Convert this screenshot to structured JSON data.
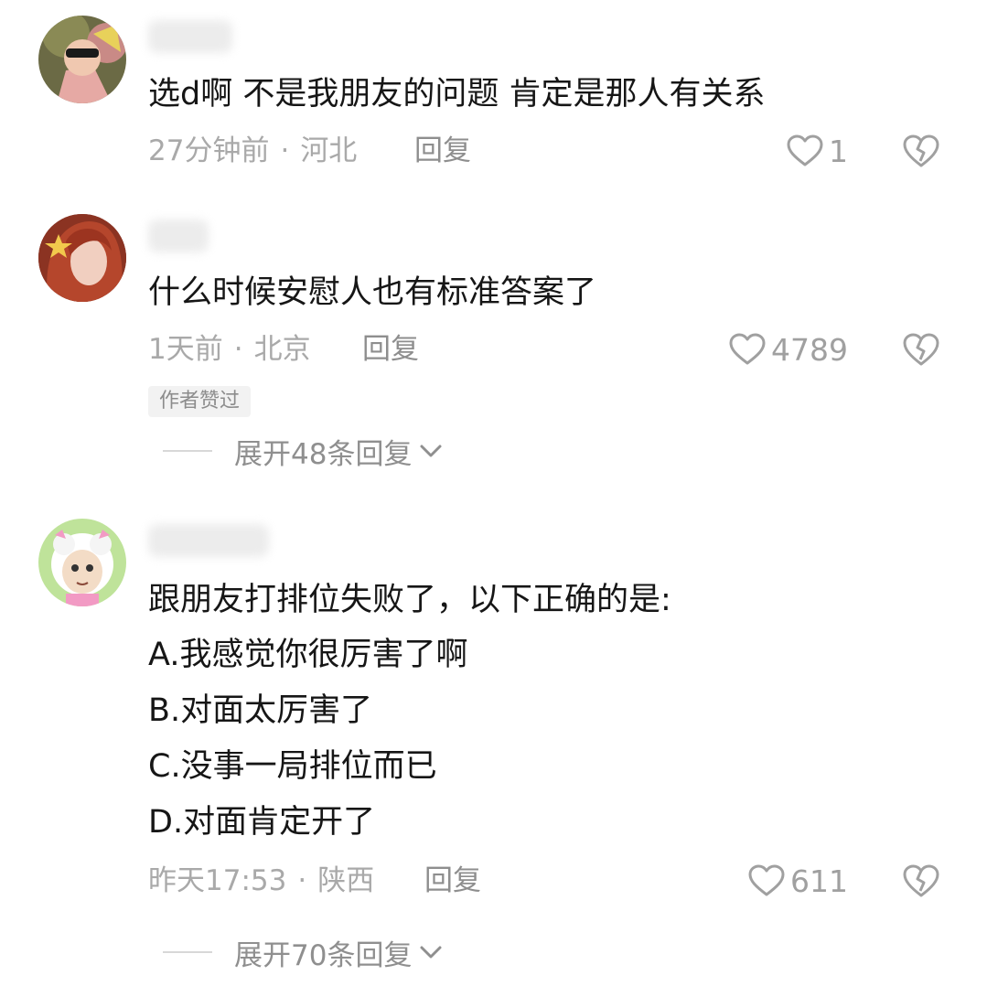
{
  "comments": [
    {
      "text_lines": [
        "选d啊  不是我朋友的问题  肯定是那人有关系"
      ],
      "time": "27分钟前",
      "location": "河北",
      "reply_label": "回复",
      "likes": "1"
    },
    {
      "text_lines": [
        "什么时候安慰人也有标准答案了"
      ],
      "time": "1天前",
      "location": "北京",
      "reply_label": "回复",
      "likes": "4789",
      "badge": "作者赞过",
      "expand_label": "展开48条回复"
    },
    {
      "text_lines": [
        "跟朋友打排位失败了，以下正确的是:",
        "A.我感觉你很厉害了啊",
        "B.对面太厉害了",
        "C.没事一局排位而已",
        "D.对面肯定开了"
      ],
      "time": "昨天17:53",
      "location": "陕西",
      "reply_label": "回复",
      "likes": "611",
      "expand_label": "展开70条回复"
    }
  ],
  "icons": {
    "like": "heart-outline-icon",
    "dislike": "broken-heart-icon",
    "expand": "chevron-down-icon"
  },
  "colors": {
    "text": "#161616",
    "meta": "#a9a9a9",
    "badge_bg": "#f2f2f2"
  }
}
